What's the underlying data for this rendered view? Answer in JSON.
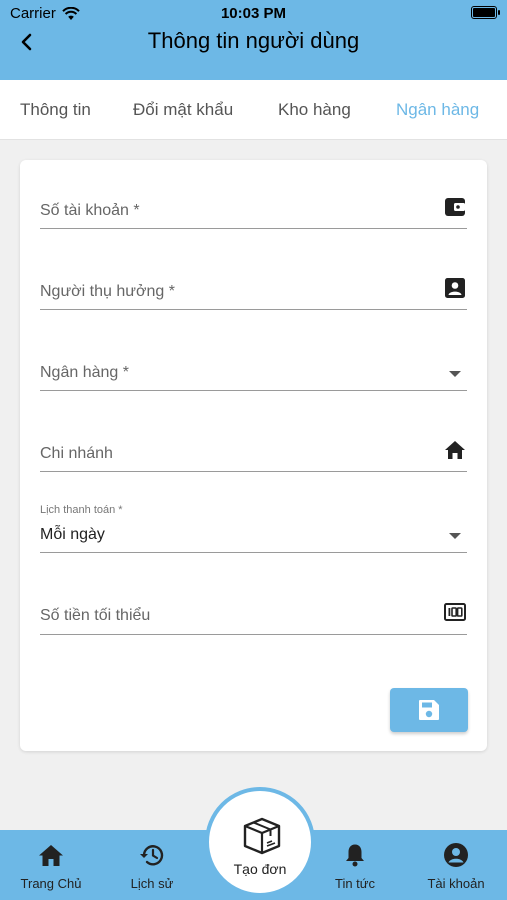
{
  "status": {
    "carrier": "Carrier",
    "time": "10:03 PM"
  },
  "header": {
    "title": "Thông tin người dùng"
  },
  "tabs": [
    {
      "label": "Thông tin"
    },
    {
      "label": "Đổi mật khẩu"
    },
    {
      "label": "Kho hàng"
    },
    {
      "label": "Ngân hàng",
      "active": true
    }
  ],
  "form": {
    "account_number": {
      "placeholder": "Số tài khoản *",
      "icon": "wallet-icon"
    },
    "beneficiary": {
      "placeholder": "Người thụ hưởng *",
      "icon": "contact-card-icon"
    },
    "bank": {
      "placeholder": "Ngân hàng *",
      "icon": "dropdown-arrow-icon"
    },
    "branch": {
      "placeholder": "Chi nhánh",
      "icon": "home-icon"
    },
    "payment_schedule": {
      "label": "Lịch thanh toán *",
      "value": "Mỗi ngày",
      "icon": "dropdown-arrow-icon"
    },
    "min_amount": {
      "placeholder": "Số tiền tối thiểu",
      "icon": "hundred-icon"
    },
    "save_icon": "save-icon"
  },
  "bottom_nav": {
    "home": "Trang Chủ",
    "history": "Lịch sử",
    "create": "Tạo đơn",
    "news": "Tin tức",
    "account": "Tài khoản"
  },
  "colors": {
    "accent": "#6db8e6"
  }
}
